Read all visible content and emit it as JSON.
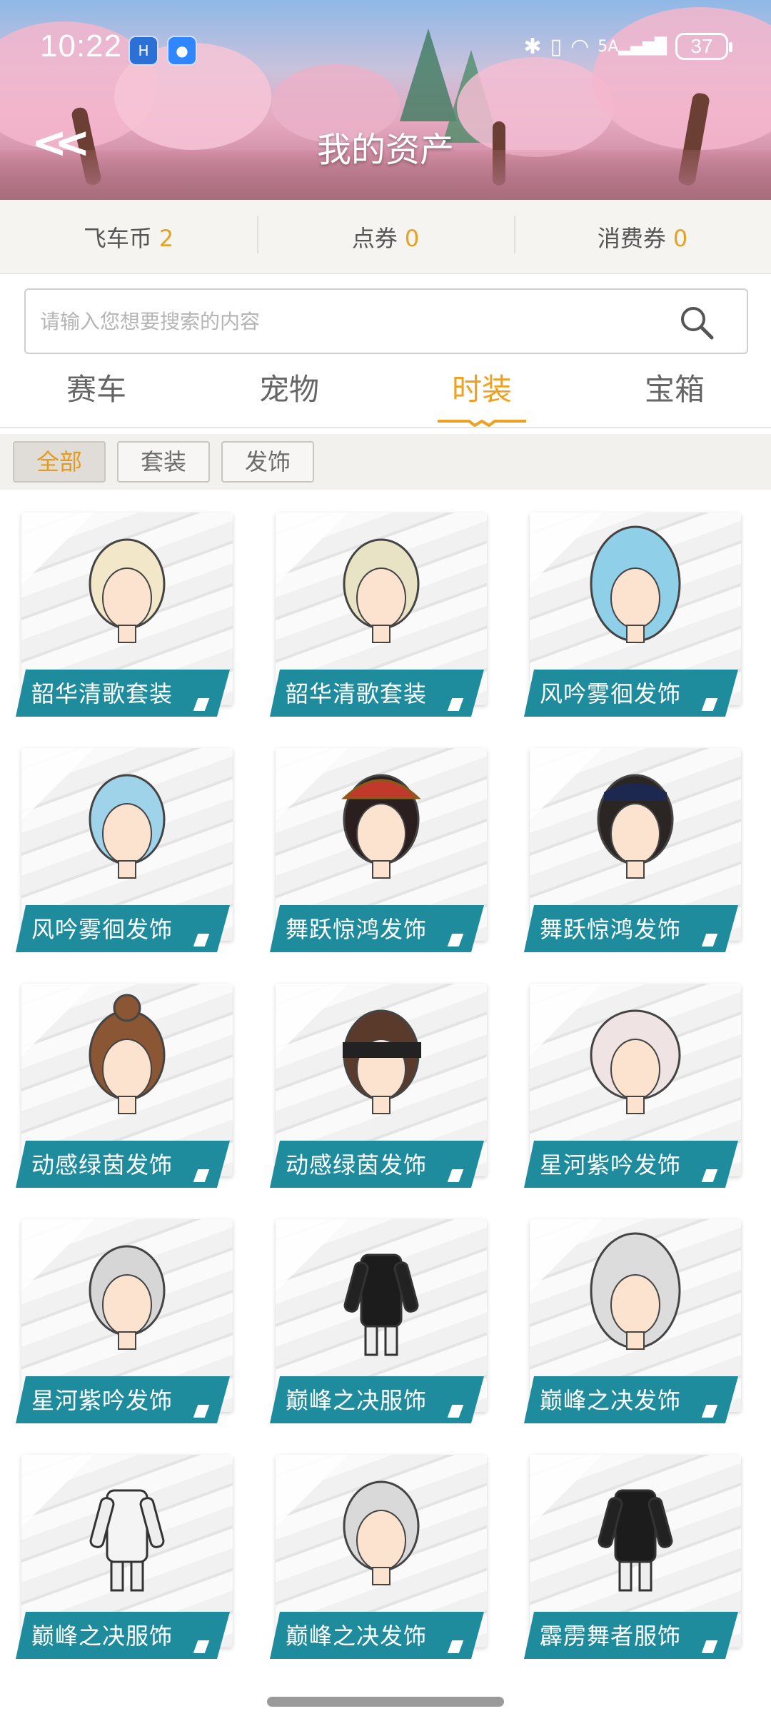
{
  "status_bar": {
    "time": "10:22",
    "network": "5A",
    "battery": "37"
  },
  "header": {
    "title": "我的资产"
  },
  "currencies": [
    {
      "label": "飞车币",
      "value": "2"
    },
    {
      "label": "点券",
      "value": "0"
    },
    {
      "label": "消费券",
      "value": "0"
    }
  ],
  "search": {
    "placeholder": "请输入您想要搜索的内容",
    "value": ""
  },
  "tabs": [
    {
      "label": "赛车",
      "active": false
    },
    {
      "label": "宠物",
      "active": false
    },
    {
      "label": "时装",
      "active": true
    },
    {
      "label": "宝箱",
      "active": false
    }
  ],
  "filters": [
    {
      "label": "全部",
      "active": true
    },
    {
      "label": "套装",
      "active": false
    },
    {
      "label": "发饰",
      "active": false
    }
  ],
  "items": [
    {
      "name": "韶华清歌套装",
      "art": "female-outfit",
      "hair": "#f2e7c8"
    },
    {
      "name": "韶华清歌套装",
      "art": "male-outfit",
      "hair": "#e8e3c4"
    },
    {
      "name": "风吟雾徊发饰",
      "art": "long-hair",
      "hair": "#8fcfe8"
    },
    {
      "name": "风吟雾徊发饰",
      "art": "short-hair",
      "hair": "#9fd3ea"
    },
    {
      "name": "舞跃惊鸿发饰",
      "art": "veil-headdress",
      "hair": "#2a1e1e"
    },
    {
      "name": "舞跃惊鸿发饰",
      "art": "cap-hair",
      "hair": "#2b2624"
    },
    {
      "name": "动感绿茵发饰",
      "art": "bun-hair",
      "hair": "#8a5634"
    },
    {
      "name": "动感绿茵发饰",
      "art": "headband-hair",
      "hair": "#5a3a2a"
    },
    {
      "name": "星河紫吟发饰",
      "art": "twin-tails",
      "hair": "#efe3e3"
    },
    {
      "name": "星河紫吟发饰",
      "art": "silver-hair",
      "hair": "#d6d6d6"
    },
    {
      "name": "巅峰之决服饰",
      "art": "outfit-dark",
      "hair": "#222"
    },
    {
      "name": "巅峰之决发饰",
      "art": "silver-long-hair",
      "hair": "#dcdcdc"
    },
    {
      "name": "巅峰之决服饰",
      "art": "outfit-white",
      "hair": "#222"
    },
    {
      "name": "巅峰之决发饰",
      "art": "silver-messy-hair",
      "hair": "#d9d9d9"
    },
    {
      "name": "霹雳舞者服饰",
      "art": "outfit-black",
      "hair": "#111"
    }
  ]
}
